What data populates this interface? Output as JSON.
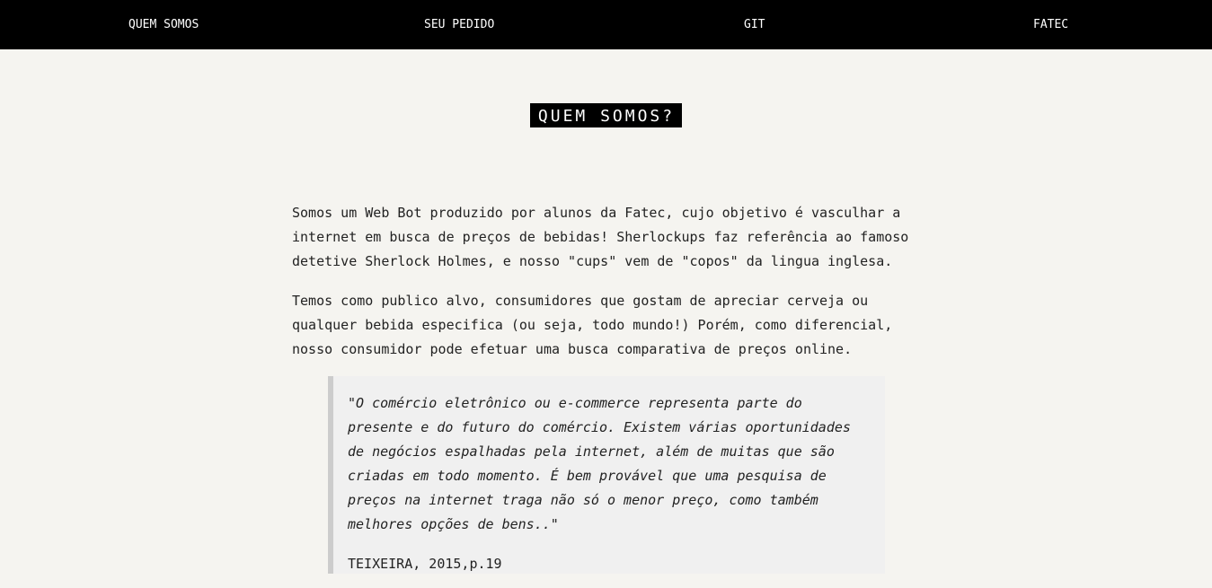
{
  "nav": {
    "items": [
      {
        "label": "QUEM SOMOS"
      },
      {
        "label": "SEU PEDIDO"
      },
      {
        "label": "GIT"
      },
      {
        "label": "FATEC"
      }
    ]
  },
  "main": {
    "title": "QUEM SOMOS?",
    "paragraphs": [
      "Somos um Web Bot produzido por alunos da Fatec, cujo objetivo é vasculhar a internet em busca de preços de bebidas! Sherlockups faz referência ao famoso detetive Sherlock Holmes, e nosso \"cups\" vem de \"copos\" da lingua inglesa.",
      "Temos como publico alvo, consumidores que gostam de apreciar cerveja ou qualquer bebida especifica (ou seja, todo mundo!) Porém, como diferencial, nosso consumidor pode efetuar uma busca comparativa de preços online."
    ],
    "quote": {
      "text": "\"O comércio eletrônico ou e-commerce representa parte do presente e do futuro do comércio. Existem várias oportunidades de negócios espalhadas pela internet, além de muitas que são criadas em todo momento. É bem provável que uma pesquisa de preços na internet traga não só o menor preço, como também melhores opções de bens..\"",
      "citation": "TEIXEIRA, 2015,p.19"
    }
  },
  "colors": {
    "nav_background": "#000000",
    "nav_text": "#ffffff",
    "page_background": "#f5f4f0",
    "title_background": "#000000",
    "quote_background": "#f0f0f0",
    "quote_border": "#cccccc"
  }
}
